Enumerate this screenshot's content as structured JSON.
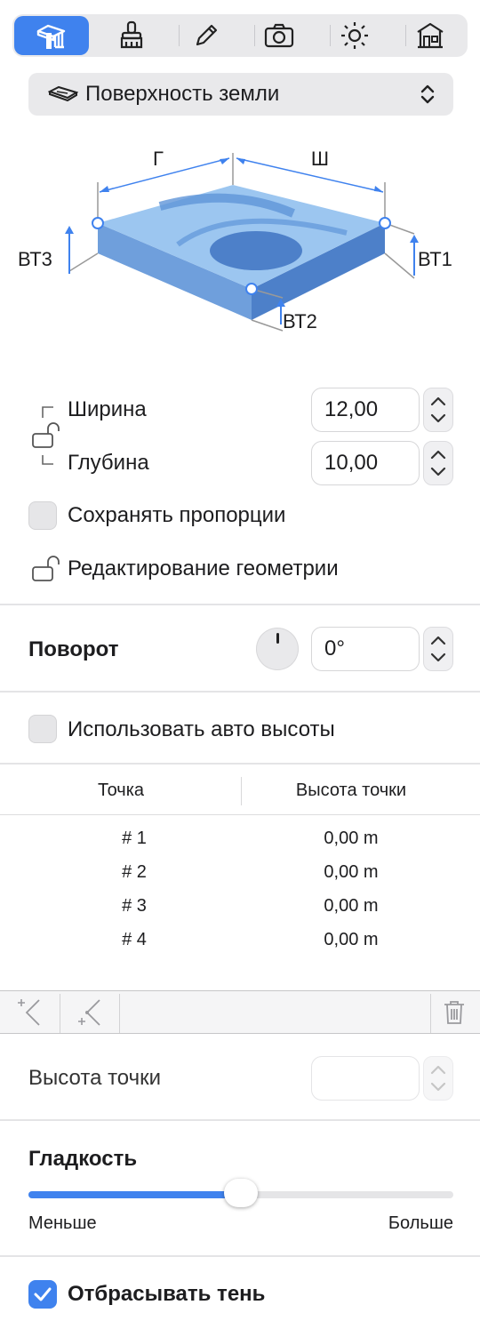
{
  "toolbar": {
    "tabs": [
      {
        "icon": "terrain-ruler-icon",
        "active": true
      },
      {
        "icon": "paint-brush-icon"
      },
      {
        "icon": "pencil-icon"
      },
      {
        "icon": "camera-icon"
      },
      {
        "icon": "sun-icon"
      },
      {
        "icon": "house-icon"
      }
    ]
  },
  "surface_popup": {
    "icon": "surface-icon",
    "label": "Поверхность земли",
    "chevron": "up-down-chevron-icon"
  },
  "diagram": {
    "label_depth": "Г",
    "label_width": "Ш",
    "label_ht1": "ВТ1",
    "label_ht2": "ВТ2",
    "label_ht3": "ВТ3"
  },
  "dimensions": {
    "width_label": "Ширина",
    "width_value": "12,00",
    "depth_label": "Глубина",
    "depth_value": "10,00",
    "keep_proportions_label": "Сохранять пропорции",
    "keep_proportions": false,
    "edit_geometry_label": "Редактирование геометрии"
  },
  "rotation": {
    "label": "Поворот",
    "value": "0°"
  },
  "auto_heights": {
    "label": "Использовать авто высоты",
    "checked": false
  },
  "points_table": {
    "columns": [
      "Точка",
      "Высота точки"
    ],
    "rows": [
      [
        "# 1",
        "0,00 m"
      ],
      [
        "# 2",
        "0,00 m"
      ],
      [
        "# 3",
        "0,00 m"
      ],
      [
        "# 4",
        "0,00 m"
      ]
    ]
  },
  "point_height": {
    "label": "Высота точки",
    "value": ""
  },
  "smoothness": {
    "label": "Гладкость",
    "min_label": "Меньше",
    "max_label": "Больше",
    "level_fraction": 0.5
  },
  "cast_shadow": {
    "label": "Отбрасывать тень",
    "checked": true
  },
  "colors": {
    "accent": "#3f82ee",
    "terrain_light": "#9cc6f0",
    "terrain_dark": "#4d80c9"
  }
}
